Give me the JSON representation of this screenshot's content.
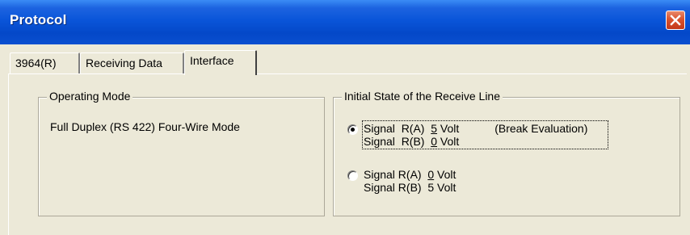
{
  "window": {
    "title": "Protocol",
    "close_icon": "close-icon"
  },
  "tabs": [
    {
      "label": "3964(R)",
      "active": false
    },
    {
      "label": "Receiving Data",
      "active": false
    },
    {
      "label": "Interface",
      "active": true
    }
  ],
  "operating_mode": {
    "title": "Operating Mode",
    "value": "Full Duplex (RS 422) Four-Wire Mode"
  },
  "receive_line": {
    "title": "Initial State of the Receive Line",
    "options": [
      {
        "selected": true,
        "line1_prefix": "Signal  R(A)  ",
        "line1_value": "5",
        "line1_unit": " Volt",
        "line1_note": "(Break Evaluation)",
        "line2_prefix": "Signal  R(B)  ",
        "line2_value": "0",
        "line2_unit": " Volt"
      },
      {
        "selected": false,
        "line1_prefix": "Signal R(A)  ",
        "line1_value": "0",
        "line1_unit": " Volt",
        "line2_prefix": "Signal R(B)  ",
        "line2_value": "5",
        "line2_unit": " Volt"
      }
    ]
  }
}
